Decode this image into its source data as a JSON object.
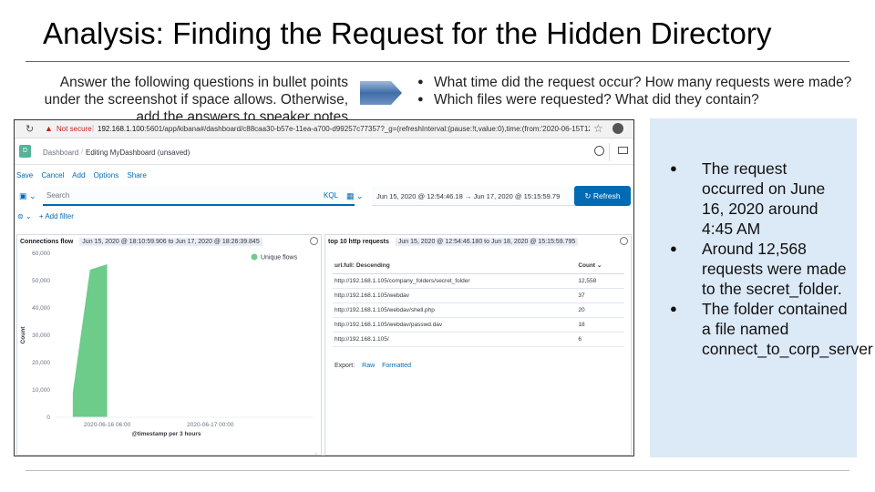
{
  "slide": {
    "title": "Analysis: Finding the Request for the Hidden Directory",
    "instructions": "Answer the following questions in bullet points under the screenshot if space allows. Otherwise, add the answers to speaker notes",
    "questions": [
      "What time did the request occur? How many requests were made?",
      "Which files were requested? What did they contain?"
    ],
    "answers": [
      "The request occurred on June 16, 2020 around 4:45 AM",
      "Around 12,568 requests were made to the secret_folder.",
      "The folder contained a file named connect_to_corp_server"
    ]
  },
  "browser": {
    "security_label": "Not secure",
    "url_host": "192.168.1.100",
    "url_rest": ":5601/app/kibana#/dashboard/c88caa30-b57e-11ea-a700-d99257c77357?_g=(refreshInterval:(pause:!t,value:0),time:(from:'2020-06-15T12:54:46.180Z',..."
  },
  "kibana": {
    "logo_letter": "D",
    "breadcrumb_dashboard": "Dashboard",
    "breadcrumb_current": "Editing MyDashboard (unsaved)",
    "menu": [
      "Save",
      "Cancel",
      "Add",
      "Options",
      "Share"
    ],
    "search_placeholder": "Search",
    "query_language": "KQL",
    "date_from": "Jun 15, 2020 @ 12:54:46.18",
    "date_to": "Jun 17, 2020 @ 15:15:59.79",
    "refresh_label": "Refresh",
    "add_filter": "+ Add filter"
  },
  "panels": {
    "connections": {
      "title": "Connections flow",
      "time_range": "Jun 15, 2020 @ 18:10:59.906 to Jun 17, 2020 @ 18:26:39.845"
    },
    "top_requests": {
      "title": "top 10 http requests",
      "time_range": "Jun 15, 2020 @ 12:54:46.180 to Jun 18, 2020 @ 15:15:59.795",
      "col_url": "url.full: Descending",
      "col_count": "Count",
      "rows": [
        {
          "url": "http://192.168.1.105/company_folders/secret_folder",
          "count": "12,558"
        },
        {
          "url": "http://192.168.1.105/webdav",
          "count": "37"
        },
        {
          "url": "http://192.168.1.105/webdav/shell.php",
          "count": "20"
        },
        {
          "url": "http://192.168.1.105/webdav/passwd.dav",
          "count": "18"
        },
        {
          "url": "http://192.168.1.105/",
          "count": "6"
        }
      ],
      "export_label": "Export:",
      "export_raw": "Raw",
      "export_formatted": "Formatted"
    }
  },
  "chart_data": {
    "type": "area",
    "title": "",
    "xlabel": "@timestamp per 3 hours",
    "ylabel": "Count",
    "ylim": [
      0,
      60000
    ],
    "yticks": [
      "0",
      "10,000",
      "20,000",
      "30,000",
      "40,000",
      "50,000",
      "60,000"
    ],
    "xticks": [
      "2020-06-16 06:00",
      "2020-06-17 00:00"
    ],
    "legend": "Unique flows",
    "legend_position": "top-right",
    "color": "#6dcc8a",
    "series": [
      {
        "name": "Unique flows",
        "x": [
          "2020-06-16 00:00",
          "2020-06-16 03:00",
          "2020-06-16 06:00"
        ],
        "values": [
          9000,
          54000,
          56000
        ]
      }
    ]
  }
}
